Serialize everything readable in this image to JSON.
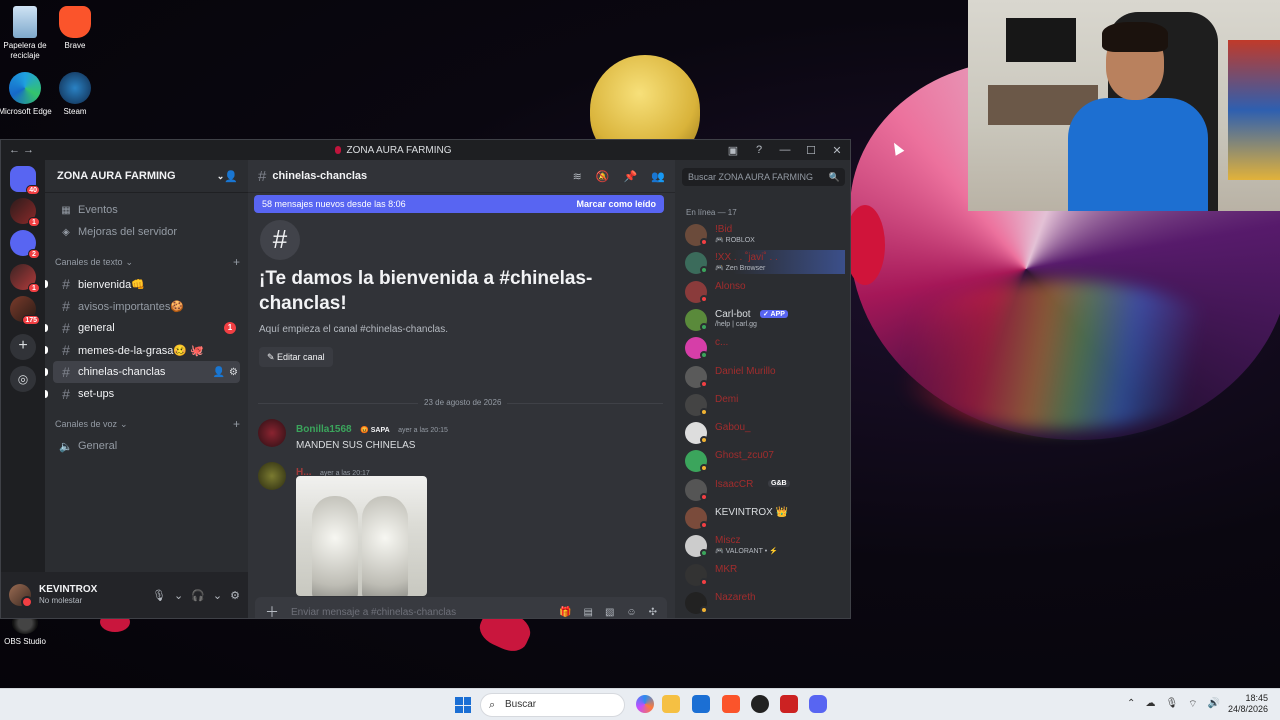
{
  "desktop": {
    "icons": [
      {
        "label": "Papelera de reciclaje"
      },
      {
        "label": "Brave"
      },
      {
        "label": "Microsoft Edge"
      },
      {
        "label": "Steam"
      },
      {
        "label": "OBS Studio"
      }
    ]
  },
  "window": {
    "title": "ZONA AURA FARMING",
    "nav": "← →",
    "controls": [
      "▣",
      "?",
      "—",
      "☐",
      "✕"
    ]
  },
  "servers": {
    "badges": [
      "40",
      "1",
      "2",
      "1",
      "175"
    ]
  },
  "sidebar": {
    "guild_name": "ZONA AURA FARMING",
    "events_label": "Eventos",
    "boost_label": "Mejoras del servidor",
    "text_category": "Canales de texto",
    "voice_category": "Canales de voz",
    "text_channels": [
      {
        "name": "bienvenida👊",
        "state": "unread"
      },
      {
        "name": "avisos-importantes🍪",
        "state": "muted"
      },
      {
        "name": "general",
        "state": "unread",
        "mentions": "1"
      },
      {
        "name": "memes-de-la-grasa🥴 🐙",
        "state": "unread"
      },
      {
        "name": "chinelas-chanclas",
        "state": "active"
      },
      {
        "name": "set-ups",
        "state": "unread"
      }
    ],
    "voice_channels": [
      {
        "name": "General"
      }
    ]
  },
  "user_panel": {
    "name": "KEVINTROX",
    "status": "No molestar"
  },
  "chat": {
    "channel": "chinelas-chanclas",
    "new_messages_bar": "58 mensajes nuevos desde las 8:06",
    "mark_read": "Marcar como leído",
    "welcome_title": "¡Te damos la bienvenida a #chinelas-chanclas!",
    "welcome_sub": "Aquí empieza el canal #chinelas-chanclas.",
    "edit_channel": "Editar canal",
    "date_divider": "23 de agosto de 2026",
    "messages": [
      {
        "author": "Bonilla1568",
        "tag": "SAPA",
        "time": "ayer a las 20:15",
        "text": "MANDEN SUS CHINELAS",
        "color": "#3ba55c"
      },
      {
        "author": "H...",
        "tag": "",
        "time": "ayer a las 20:17",
        "text": "",
        "color": "#a03b3b"
      }
    ],
    "composer_placeholder": "Enviar mensaje a #chinelas-chanclas"
  },
  "members": {
    "search_placeholder": "Buscar ZONA AURA FARMING",
    "online_header": "En línea — 17",
    "list": [
      {
        "name": "!Bid",
        "sub": "🎮 ROBLOX",
        "color": "#a12d2d"
      },
      {
        "name": "!XX . . ˚javi˚ . .",
        "sub": "🎮 Zen Browser",
        "color": "#a12d2d"
      },
      {
        "name": "Alonso",
        "sub": "",
        "color": "#a12d2d"
      },
      {
        "name": "Carl-bot",
        "sub": "/help | carl.gg",
        "color": "#dbdee1",
        "app": "✓ APP"
      },
      {
        "name": "c...",
        "sub": "",
        "color": "#a12d2d"
      },
      {
        "name": "Daniel Murillo",
        "sub": "",
        "color": "#a12d2d"
      },
      {
        "name": "Demi",
        "sub": "",
        "color": "#a12d2d"
      },
      {
        "name": "Gabou_",
        "sub": "",
        "color": "#a12d2d"
      },
      {
        "name": "Ghost_zcu07",
        "sub": "",
        "color": "#a12d2d"
      },
      {
        "name": "IsaacCR",
        "sub": "",
        "color": "#a12d2d",
        "tag": "G&B"
      },
      {
        "name": "KEVINTROX 👑",
        "sub": "",
        "color": "#dbdee1"
      },
      {
        "name": "Miscz",
        "sub": "🎮 VALORANT • ⚡",
        "color": "#a12d2d"
      },
      {
        "name": "MKR",
        "sub": "",
        "color": "#a12d2d"
      },
      {
        "name": "Nazareth",
        "sub": "",
        "color": "#a12d2d"
      }
    ]
  },
  "taskbar": {
    "search_label": "Buscar",
    "time": "18:45",
    "date": "24/8/2026"
  }
}
